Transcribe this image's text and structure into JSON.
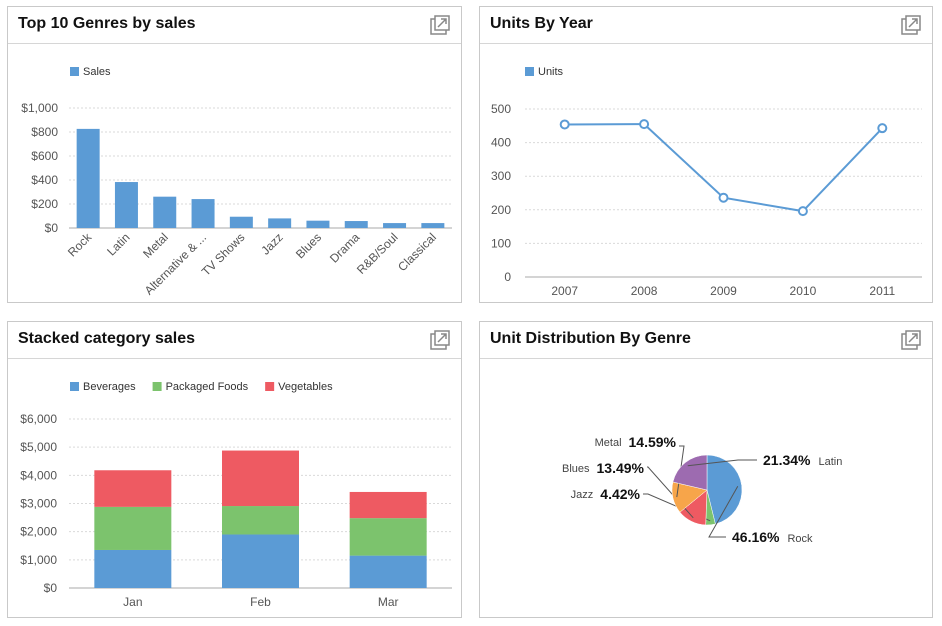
{
  "panels": {
    "genres": {
      "title": "Top 10 Genres by sales"
    },
    "units": {
      "title": "Units By Year"
    },
    "stacked": {
      "title": "Stacked category sales"
    },
    "dist": {
      "title": "Unit Distribution By Genre"
    }
  },
  "icons": {
    "expand": "expand-icon"
  },
  "colors": {
    "blue": "#5b9bd5",
    "green": "#7cc36d",
    "red": "#ee5a62",
    "orange": "#f7a54a",
    "purple": "#9d6bb0"
  },
  "chart_data": [
    {
      "id": "genres",
      "type": "bar",
      "title": "Top 10 Genres by sales",
      "categories": [
        "Rock",
        "Latin",
        "Metal",
        "Alternative & ...",
        "TV Shows",
        "Jazz",
        "Blues",
        "Drama",
        "R&B/Soul",
        "Classical"
      ],
      "series": [
        {
          "name": "Sales",
          "values": [
            826,
            383,
            261,
            241,
            94,
            80,
            61,
            58,
            41,
            41
          ]
        }
      ],
      "ylim": [
        0,
        1000
      ],
      "yticks": [
        0,
        200,
        400,
        600,
        800,
        1000
      ],
      "ytick_labels": [
        "$0",
        "$200",
        "$400",
        "$600",
        "$800",
        "$1,000"
      ],
      "legend": "top-left",
      "grid": true
    },
    {
      "id": "units",
      "type": "line",
      "title": "Units By Year",
      "x": [
        "2007",
        "2008",
        "2009",
        "2010",
        "2011"
      ],
      "series": [
        {
          "name": "Units",
          "values": [
            454,
            455,
            236,
            196,
            443
          ]
        }
      ],
      "ylim": [
        0,
        500
      ],
      "yticks": [
        0,
        100,
        200,
        300,
        400,
        500
      ],
      "ytick_labels": [
        "0",
        "100",
        "200",
        "300",
        "400",
        "500"
      ],
      "legend": "top-left",
      "grid": true
    },
    {
      "id": "stacked",
      "type": "bar",
      "stacked": true,
      "title": "Stacked category sales",
      "categories": [
        "Jan",
        "Feb",
        "Mar"
      ],
      "series": [
        {
          "name": "Beverages",
          "values": [
            1350,
            1900,
            1150
          ]
        },
        {
          "name": "Packaged Foods",
          "values": [
            1530,
            1010,
            1330
          ]
        },
        {
          "name": "Vegetables",
          "values": [
            1300,
            1970,
            930
          ]
        }
      ],
      "ylim": [
        0,
        6000
      ],
      "yticks": [
        0,
        1000,
        2000,
        3000,
        4000,
        5000,
        6000
      ],
      "ytick_labels": [
        "$0",
        "$1,000",
        "$2,000",
        "$3,000",
        "$4,000",
        "$5,000",
        "$6,000"
      ],
      "legend": "top-left",
      "grid": true
    },
    {
      "id": "dist",
      "type": "pie",
      "title": "Unit Distribution By Genre",
      "slices": [
        {
          "name": "Rock",
          "label": "46.16%",
          "value": 46.16
        },
        {
          "name": "Jazz",
          "label": "4.42%",
          "value": 4.42
        },
        {
          "name": "Blues",
          "label": "13.49%",
          "value": 13.49
        },
        {
          "name": "Metal",
          "label": "14.59%",
          "value": 14.59
        },
        {
          "name": "Latin",
          "label": "21.34%",
          "value": 21.34
        }
      ]
    }
  ]
}
